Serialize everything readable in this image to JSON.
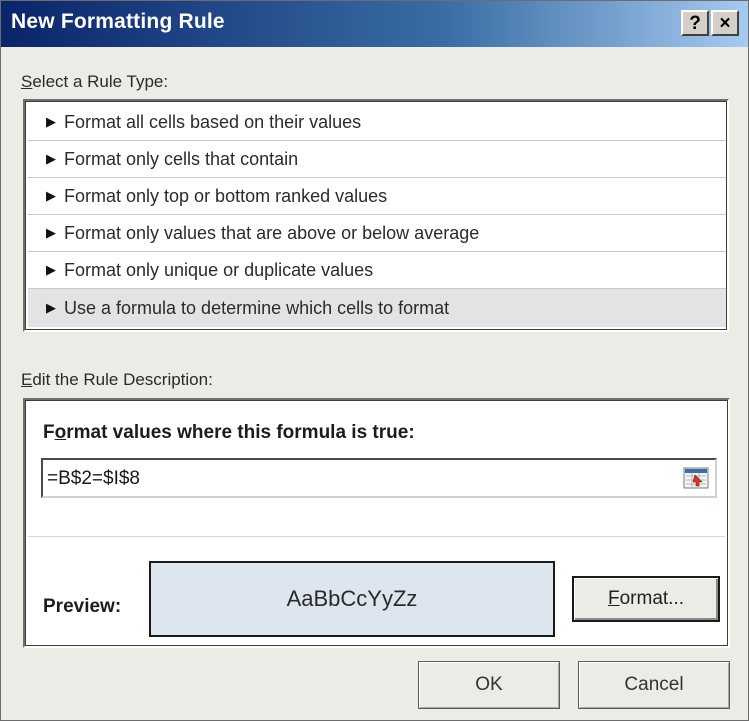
{
  "window": {
    "title": "New Formatting Rule",
    "help_label": "?",
    "close_label": "×"
  },
  "rule_type": {
    "label_hotkey": "S",
    "label_rest": "elect a Rule Type:",
    "items": [
      {
        "label": "Format all cells based on their values",
        "selected": false
      },
      {
        "label": "Format only cells that contain",
        "selected": false
      },
      {
        "label": "Format only top or bottom ranked values",
        "selected": false
      },
      {
        "label": "Format only values that are above or below average",
        "selected": false
      },
      {
        "label": "Format only unique or duplicate values",
        "selected": false
      },
      {
        "label": "Use a formula to determine which cells to format",
        "selected": true
      }
    ]
  },
  "description": {
    "label_hotkey": "E",
    "label_rest": "dit the Rule Description:",
    "heading_pre": "F",
    "heading_hotkey": "o",
    "heading_rest": "rmat values where this formula is true:",
    "formula_value": "=B$2=$I$8",
    "preview_label": "Preview:",
    "preview_sample": "AaBbCcYyZz",
    "format_button_hotkey": "F",
    "format_button_rest": "ormat..."
  },
  "buttons": {
    "ok": "OK",
    "cancel": "Cancel"
  },
  "icons": {
    "arrow": "play-arrow-icon",
    "collapse": "collapse-dialog-icon"
  },
  "colors": {
    "title_bar": "#0a246a",
    "preview_fill": "#dde6ee",
    "selected_row": "#e3e3e6"
  }
}
